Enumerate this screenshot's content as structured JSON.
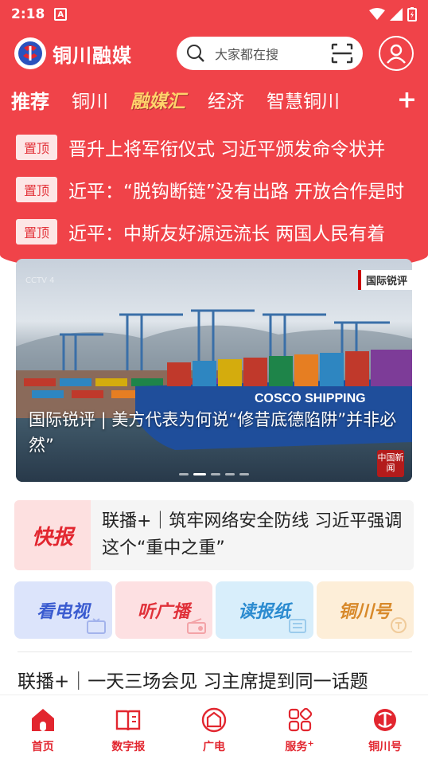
{
  "status_bar": {
    "time": "2:18",
    "notification_icon": "A"
  },
  "header": {
    "app_name": "铜川融媒",
    "search_placeholder": "大家都在搜"
  },
  "tabs": [
    {
      "label": "推荐"
    },
    {
      "label": "铜川"
    },
    {
      "label": "融媒汇"
    },
    {
      "label": "经济"
    },
    {
      "label": "智慧铜川"
    }
  ],
  "tab_add_label": "+",
  "pinned": {
    "badge": "置顶",
    "items": [
      "晋升上将军衔仪式 习近平颁发命令状并",
      "近平：“脱钩断链”没有出路 开放合作是时",
      "近平：中斯友好源远流长 两国人民有着"
    ]
  },
  "banner": {
    "caption": "国际锐评 | 美方代表为何说“修昔底德陷阱”并非必然”",
    "corner_tag": "国际锐评",
    "cn_logo": "中国新闻",
    "watermark": "CCTV 4",
    "slides": 5,
    "active_slide": 1
  },
  "kuaibao": {
    "label": "快报",
    "text": "联播+｜筑牢网络安全防线 习近平强调这个“重中之重”"
  },
  "media": [
    {
      "label": "看电视",
      "icon": "tv-icon"
    },
    {
      "label": "听广播",
      "icon": "radio-icon"
    },
    {
      "label": "读报纸",
      "icon": "newspaper-icon"
    },
    {
      "label": "铜川号",
      "icon": "account-icon"
    }
  ],
  "news_line": "联播+｜一天三场会见 习主席提到同一话题",
  "bottom_nav": [
    {
      "label": "首页",
      "icon": "home-icon"
    },
    {
      "label": "数字报",
      "icon": "book-icon"
    },
    {
      "label": "广电",
      "icon": "broadcast-icon"
    },
    {
      "label": "服务",
      "icon": "grid-icon",
      "sup": "+"
    },
    {
      "label": "铜川号",
      "icon": "tongchuan-logo-icon"
    }
  ],
  "colors": {
    "brand_red": "#f04349",
    "nav_red": "#e2262f"
  }
}
